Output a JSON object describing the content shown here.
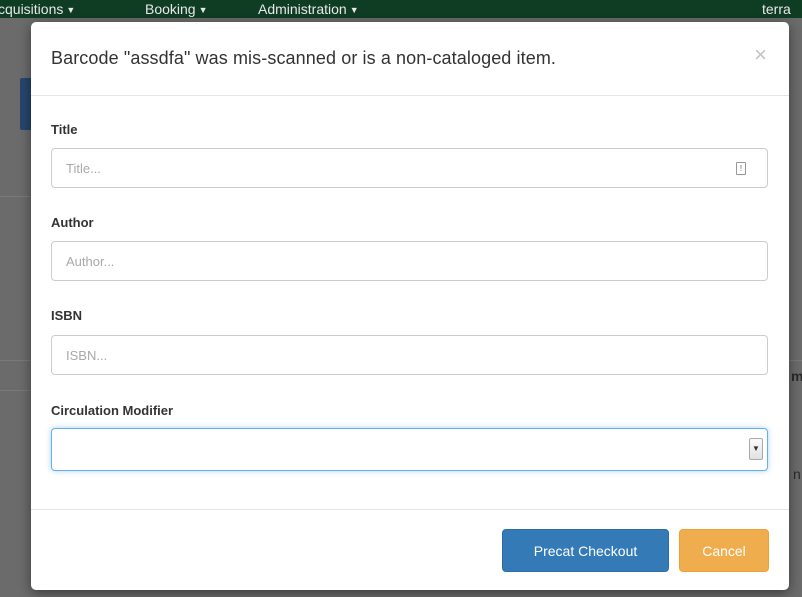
{
  "navbar": {
    "items": [
      {
        "label": "cquisitions"
      },
      {
        "label": "Booking"
      },
      {
        "label": "Administration"
      }
    ],
    "user_fragment": "terra"
  },
  "background": {
    "fragments": [
      "m",
      "n"
    ]
  },
  "modal": {
    "title": "Barcode \"assdfa\" was mis-scanned or is a non-cataloged item.",
    "close_label": "×",
    "fields": {
      "title": {
        "label": "Title",
        "placeholder": "Title...",
        "value": ""
      },
      "author": {
        "label": "Author",
        "placeholder": "Author...",
        "value": ""
      },
      "isbn": {
        "label": "ISBN",
        "placeholder": "ISBN...",
        "value": ""
      },
      "circ_modifier": {
        "label": "Circulation Modifier",
        "selected": ""
      }
    },
    "buttons": {
      "precat_checkout": "Precat Checkout",
      "cancel": "Cancel"
    }
  },
  "colors": {
    "primary": "#337ab7",
    "warning": "#f0ad4e",
    "navbar": "#0f3d24"
  },
  "icons": {
    "title_field": "input-indicator-icon",
    "close": "close-icon",
    "select": "chevron-down-icon"
  }
}
